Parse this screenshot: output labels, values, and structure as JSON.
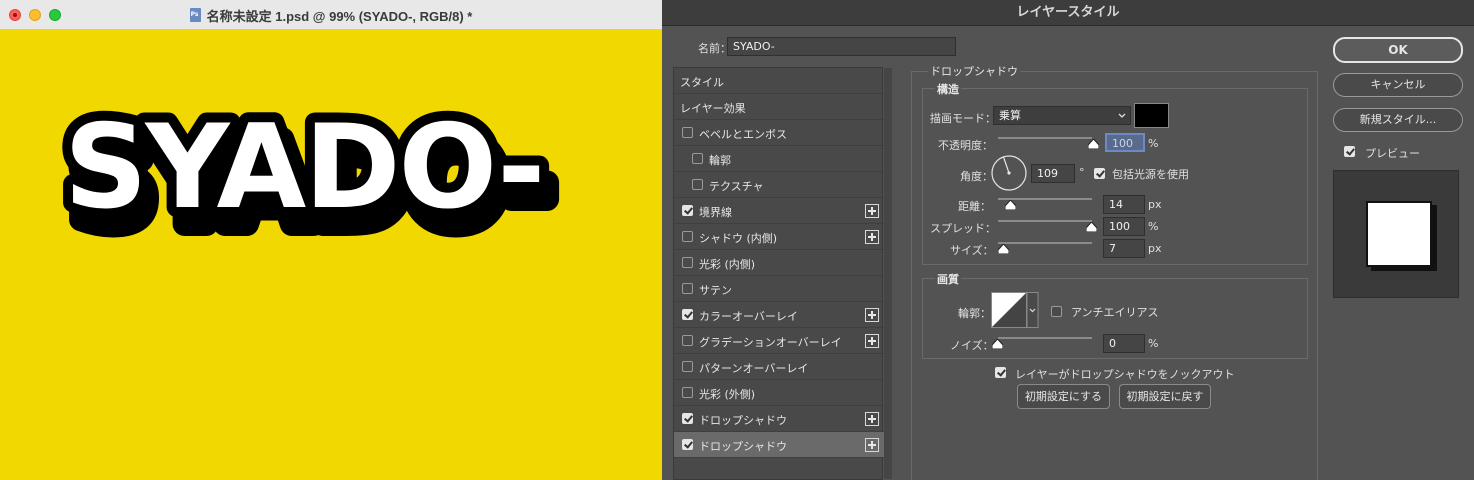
{
  "doc": {
    "title": "名称未設定 1.psd @ 99% (SYADO-, RGB/8) *",
    "canvas_text": "SYADO-",
    "canvas_color": "#f0d800"
  },
  "dialog": {
    "title": "レイヤースタイル",
    "name_label": "名前：",
    "name_value": "SYADO-",
    "styles_list": [
      {
        "label": "スタイル",
        "checkbox": false,
        "checked": false,
        "plus": false,
        "selected": false,
        "indent": 0
      },
      {
        "label": "レイヤー効果",
        "checkbox": false,
        "checked": false,
        "plus": false,
        "selected": false,
        "indent": 0
      },
      {
        "label": "ベベルとエンボス",
        "checkbox": true,
        "checked": false,
        "plus": false,
        "selected": false,
        "indent": 0
      },
      {
        "label": "輪郭",
        "checkbox": true,
        "checked": false,
        "plus": false,
        "selected": false,
        "indent": 1
      },
      {
        "label": "テクスチャ",
        "checkbox": true,
        "checked": false,
        "plus": false,
        "selected": false,
        "indent": 1
      },
      {
        "label": "境界線",
        "checkbox": true,
        "checked": true,
        "plus": true,
        "selected": false,
        "indent": 0
      },
      {
        "label": "シャドウ (内側)",
        "checkbox": true,
        "checked": false,
        "plus": true,
        "selected": false,
        "indent": 0
      },
      {
        "label": "光彩 (内側)",
        "checkbox": true,
        "checked": false,
        "plus": false,
        "selected": false,
        "indent": 0
      },
      {
        "label": "サテン",
        "checkbox": true,
        "checked": false,
        "plus": false,
        "selected": false,
        "indent": 0
      },
      {
        "label": "カラーオーバーレイ",
        "checkbox": true,
        "checked": true,
        "plus": true,
        "selected": false,
        "indent": 0
      },
      {
        "label": "グラデーションオーバーレイ",
        "checkbox": true,
        "checked": false,
        "plus": true,
        "selected": false,
        "indent": 0
      },
      {
        "label": "パターンオーバーレイ",
        "checkbox": true,
        "checked": false,
        "plus": false,
        "selected": false,
        "indent": 0
      },
      {
        "label": "光彩 (外側)",
        "checkbox": true,
        "checked": false,
        "plus": false,
        "selected": false,
        "indent": 0
      },
      {
        "label": "ドロップシャドウ",
        "checkbox": true,
        "checked": true,
        "plus": true,
        "selected": false,
        "indent": 0
      },
      {
        "label": "ドロップシャドウ",
        "checkbox": true,
        "checked": true,
        "plus": true,
        "selected": true,
        "indent": 0
      }
    ],
    "drop_shadow": {
      "section_title": "ドロップシャドウ",
      "structure_title": "構造",
      "blend_mode_label": "描画モード：",
      "blend_mode_value": "乗算",
      "shadow_color": "#000000",
      "opacity_label": "不透明度：",
      "opacity_value": "100",
      "opacity_unit": "%",
      "angle_label": "角度：",
      "angle_value": "109",
      "angle_unit": "°",
      "global_light_label": "包括光源を使用",
      "global_light_checked": true,
      "distance_label": "距離：",
      "distance_value": "14",
      "distance_unit": "px",
      "spread_label": "スプレッド：",
      "spread_value": "100",
      "spread_unit": "%",
      "size_label": "サイズ：",
      "size_value": "7",
      "size_unit": "px",
      "quality_title": "画質",
      "contour_label": "輪郭：",
      "antialias_label": "アンチエイリアス",
      "antialias_checked": false,
      "noise_label": "ノイズ：",
      "noise_value": "0",
      "noise_unit": "%",
      "knockout_label": "レイヤーがドロップシャドウをノックアウト",
      "knockout_checked": true,
      "make_default_label": "初期設定にする",
      "reset_default_label": "初期設定に戻す"
    },
    "ok_label": "OK",
    "cancel_label": "キャンセル",
    "new_style_label": "新規スタイル...",
    "preview_label": "プレビュー",
    "preview_checked": true
  }
}
